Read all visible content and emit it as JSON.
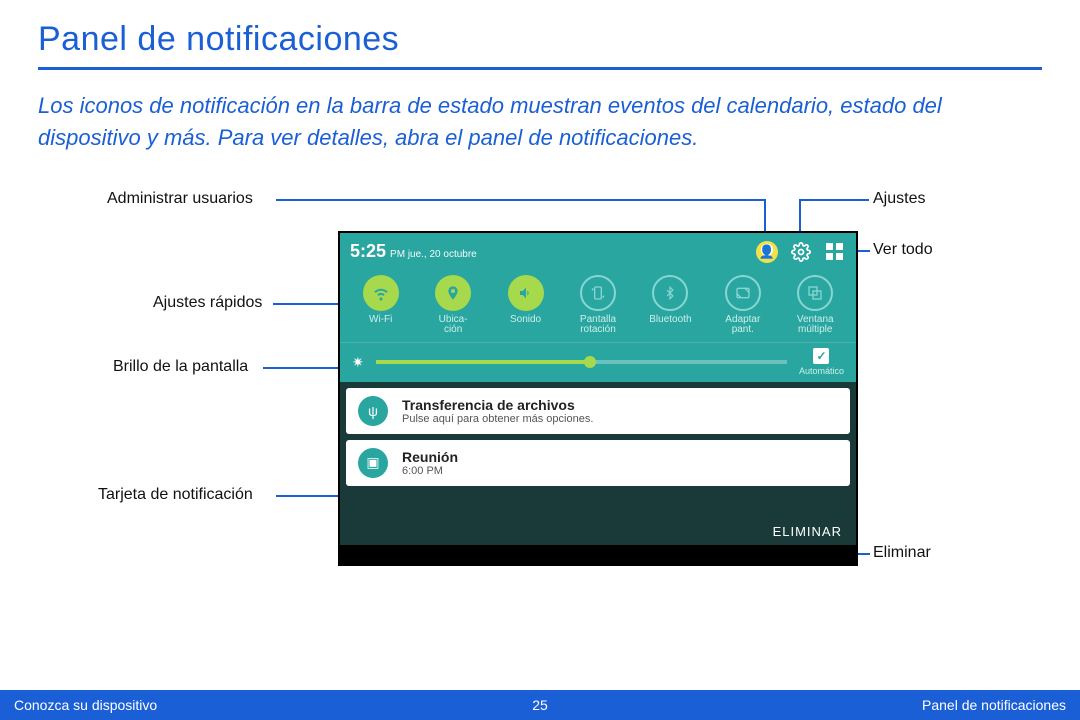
{
  "title": "Panel de notificaciones",
  "intro": "Los iconos de notificación en la barra de estado muestran eventos del calendario, estado del dispositivo y más. Para ver detalles, abra el panel de notificaciones.",
  "callouts": {
    "manage_users": "Administrar usuarios",
    "quick_settings": "Ajustes rápidos",
    "brightness": "Brillo de la pantalla",
    "notif_card": "Tarjeta de notificación",
    "settings": "Ajustes",
    "view_all": "Ver todo",
    "clear": "Eliminar"
  },
  "status": {
    "time": "5:25",
    "ampm": "PM",
    "date": "jue., 20 octubre"
  },
  "qs": {
    "items": [
      {
        "label": "Wi-Fi",
        "on": true,
        "glyph": "wifi"
      },
      {
        "label": "Ubica-\nción",
        "on": true,
        "glyph": "pin"
      },
      {
        "label": "Sonido",
        "on": true,
        "glyph": "sound"
      },
      {
        "label": "Pantalla\nrotación",
        "on": false,
        "glyph": "rotate"
      },
      {
        "label": "Bluetooth",
        "on": false,
        "glyph": "bt"
      },
      {
        "label": "Adaptar\npant.",
        "on": false,
        "glyph": "adapt"
      },
      {
        "label": "Ventana\nmúltiple",
        "on": false,
        "glyph": "multi"
      }
    ]
  },
  "brightness": {
    "auto_label": "Automático"
  },
  "cards": [
    {
      "title": "Transferencia de archivos",
      "sub": "Pulse aquí para obtener más opciones.",
      "icon": "usb"
    },
    {
      "title": "Reunión",
      "sub": "6:00 PM",
      "icon": "cal"
    }
  ],
  "clear_button": "ELIMINAR",
  "footer": {
    "left": "Conozca su dispositivo",
    "page": "25",
    "right": "Panel de notificaciones"
  }
}
